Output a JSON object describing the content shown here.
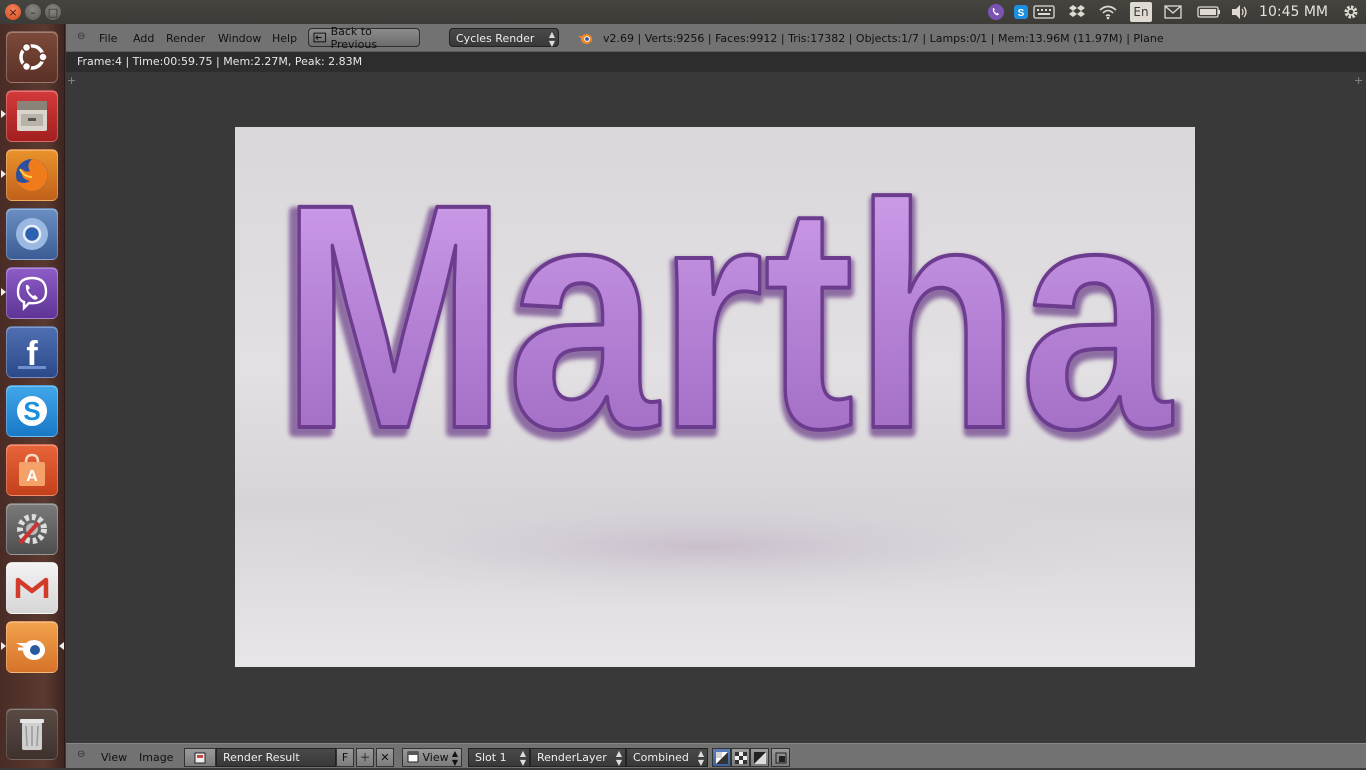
{
  "top_panel": {
    "clock": "10:45 MM",
    "keyboard_layout": "En",
    "tray_icons": [
      "viber-icon",
      "skype-icon",
      "keyboard-icon",
      "dropbox-icon",
      "wifi-icon",
      "keyboard-layout",
      "mail-icon",
      "battery-icon",
      "volume-icon",
      "gear-icon"
    ]
  },
  "launcher": {
    "items": [
      "ubuntu-dash",
      "files",
      "firefox",
      "chromium",
      "viber",
      "facebook",
      "skype",
      "software-center",
      "system-settings",
      "gmail",
      "blender",
      "trash"
    ]
  },
  "header": {
    "menus": [
      "File",
      "Add",
      "Render",
      "Window",
      "Help"
    ],
    "back_button": "Back to Previous",
    "render_engine": "Cycles Render",
    "stats": "v2.69 | Verts:9256 | Faces:9912 | Tris:17382 | Objects:1/7 | Lamps:0/1 | Mem:13.96M (11.97M) | Plane"
  },
  "editor": {
    "info": "Frame:4 | Time:00:59.75 | Mem:2.27M, Peak: 2.83M",
    "render_text": "Martha"
  },
  "footer": {
    "menus": [
      "View",
      "Image"
    ],
    "image_name": "Render Result",
    "fake_user": "F",
    "view_mode": "View",
    "slot": "Slot 1",
    "render_layer": "RenderLayer",
    "pass": "Combined"
  },
  "colors": {
    "header_bg": "#727272",
    "editor_bg": "#393939",
    "letter_purple": "#b27ed0",
    "launcher_bg": "#4a2c26"
  }
}
